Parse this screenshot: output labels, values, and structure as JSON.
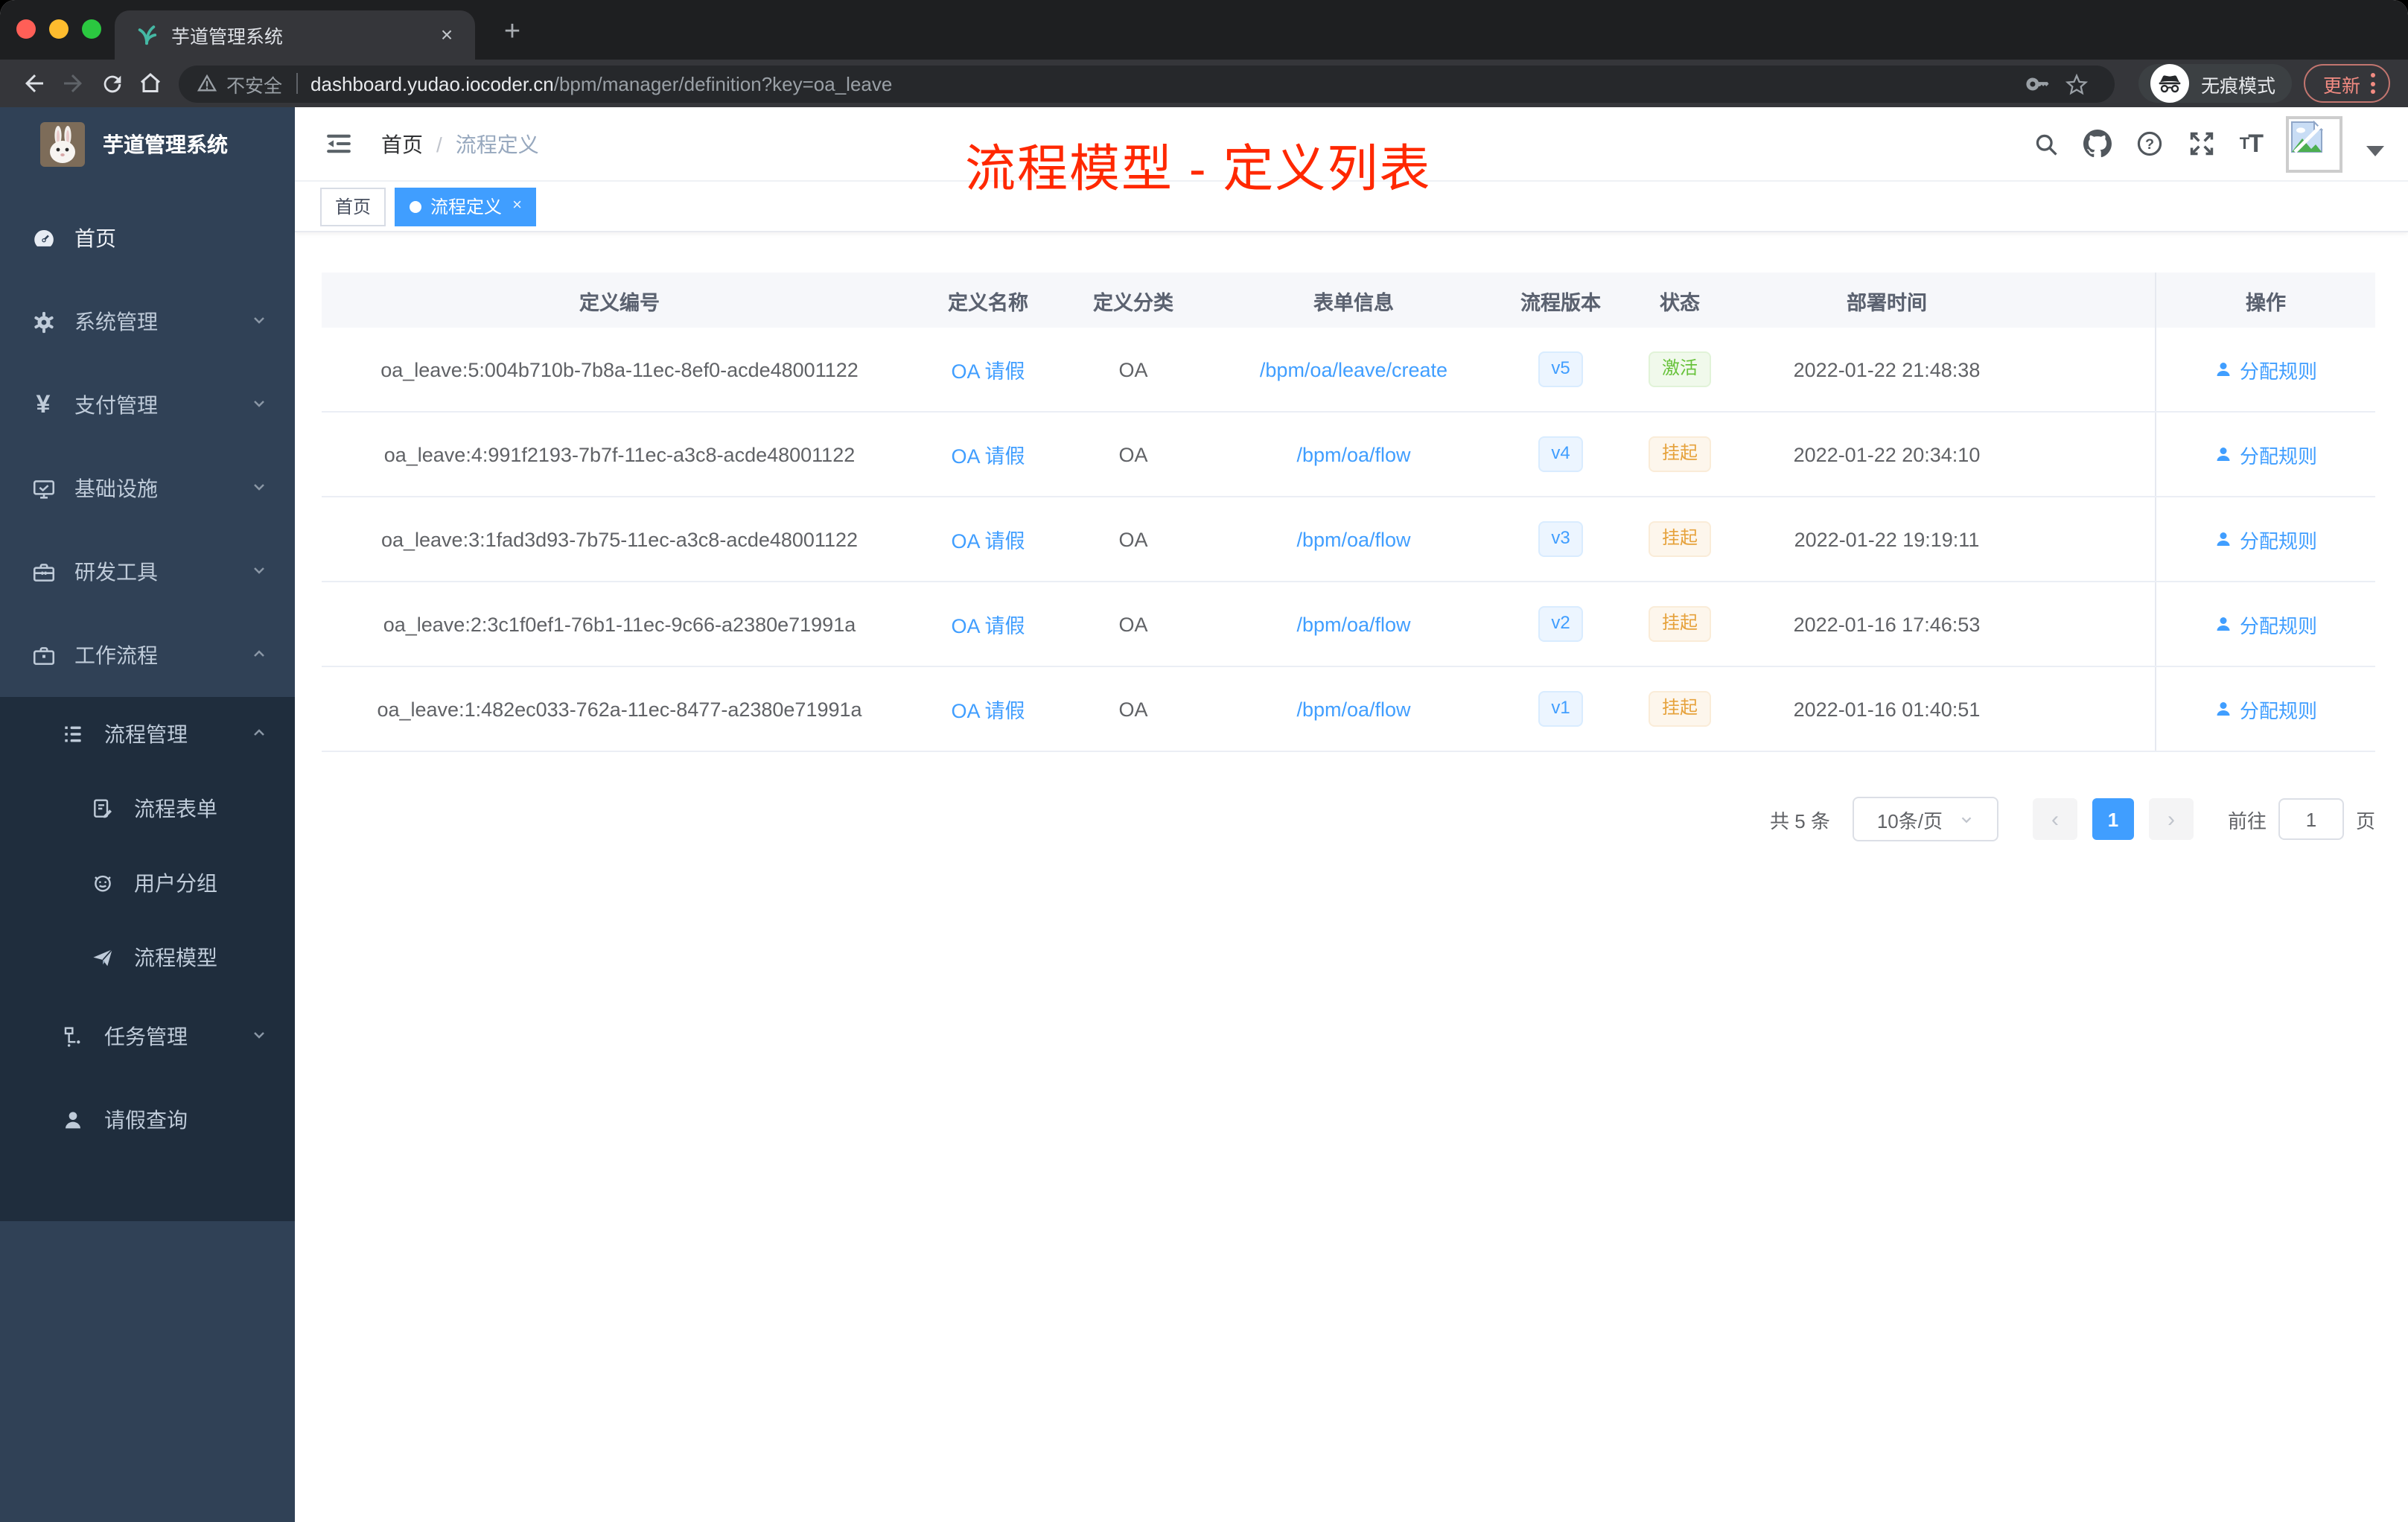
{
  "browser": {
    "tab_title": "芋道管理系统",
    "tab_close": "×",
    "new_tab": "+",
    "security_label": "不安全",
    "url_host": "dashboard.yudao.iocoder.cn",
    "url_path": "/bpm/manager/definition?key=oa_leave",
    "incognito_label": "无痕模式",
    "update_label": "更新"
  },
  "sidebar": {
    "title": "芋道管理系统",
    "items": [
      {
        "label": "首页"
      },
      {
        "label": "系统管理"
      },
      {
        "label": "支付管理"
      },
      {
        "label": "基础设施"
      },
      {
        "label": "研发工具"
      },
      {
        "label": "工作流程"
      },
      {
        "label": "流程管理"
      },
      {
        "label": "流程表单"
      },
      {
        "label": "用户分组"
      },
      {
        "label": "流程模型"
      },
      {
        "label": "任务管理"
      },
      {
        "label": "请假查询"
      }
    ]
  },
  "navbar": {
    "breadcrumb": {
      "home": "首页",
      "separator": "/",
      "current": "流程定义"
    },
    "annotation": "流程模型 - 定义列表"
  },
  "tags": {
    "home": "首页",
    "active": "流程定义",
    "close": "×"
  },
  "table": {
    "columns": [
      "定义编号",
      "定义名称",
      "定义分类",
      "表单信息",
      "流程版本",
      "状态",
      "部署时间",
      "操作"
    ],
    "rows": [
      {
        "id": "oa_leave:5:004b710b-7b8a-11ec-8ef0-acde48001122",
        "name": "OA 请假",
        "category": "OA",
        "form": "/bpm/oa/leave/create",
        "version": "v5",
        "status": "激活",
        "status_type": "success",
        "deployed": "2022-01-22 21:48:38",
        "action": "分配规则"
      },
      {
        "id": "oa_leave:4:991f2193-7b7f-11ec-a3c8-acde48001122",
        "name": "OA 请假",
        "category": "OA",
        "form": "/bpm/oa/flow",
        "version": "v4",
        "status": "挂起",
        "status_type": "warning",
        "deployed": "2022-01-22 20:34:10",
        "action": "分配规则"
      },
      {
        "id": "oa_leave:3:1fad3d93-7b75-11ec-a3c8-acde48001122",
        "name": "OA 请假",
        "category": "OA",
        "form": "/bpm/oa/flow",
        "version": "v3",
        "status": "挂起",
        "status_type": "warning",
        "deployed": "2022-01-22 19:19:11",
        "action": "分配规则"
      },
      {
        "id": "oa_leave:2:3c1f0ef1-76b1-11ec-9c66-a2380e71991a",
        "name": "OA 请假",
        "category": "OA",
        "form": "/bpm/oa/flow",
        "version": "v2",
        "status": "挂起",
        "status_type": "warning",
        "deployed": "2022-01-16 17:46:53",
        "action": "分配规则"
      },
      {
        "id": "oa_leave:1:482ec033-762a-11ec-8477-a2380e71991a",
        "name": "OA 请假",
        "category": "OA",
        "form": "/bpm/oa/flow",
        "version": "v1",
        "status": "挂起",
        "status_type": "warning",
        "deployed": "2022-01-16 01:40:51",
        "action": "分配规则"
      }
    ]
  },
  "pagination": {
    "total": "共 5 条",
    "page_size": "10条/页",
    "prev": "‹",
    "current": "1",
    "next": "›",
    "goto": "前往",
    "goto_value": "1",
    "unit": "页"
  },
  "colors": {
    "primary": "#409eff",
    "success": "#67c23a",
    "warning": "#e6a23c",
    "annotation_red": "#ff2800",
    "sidebar_bg": "#304156",
    "submenu_bg": "#1f2d3d"
  }
}
